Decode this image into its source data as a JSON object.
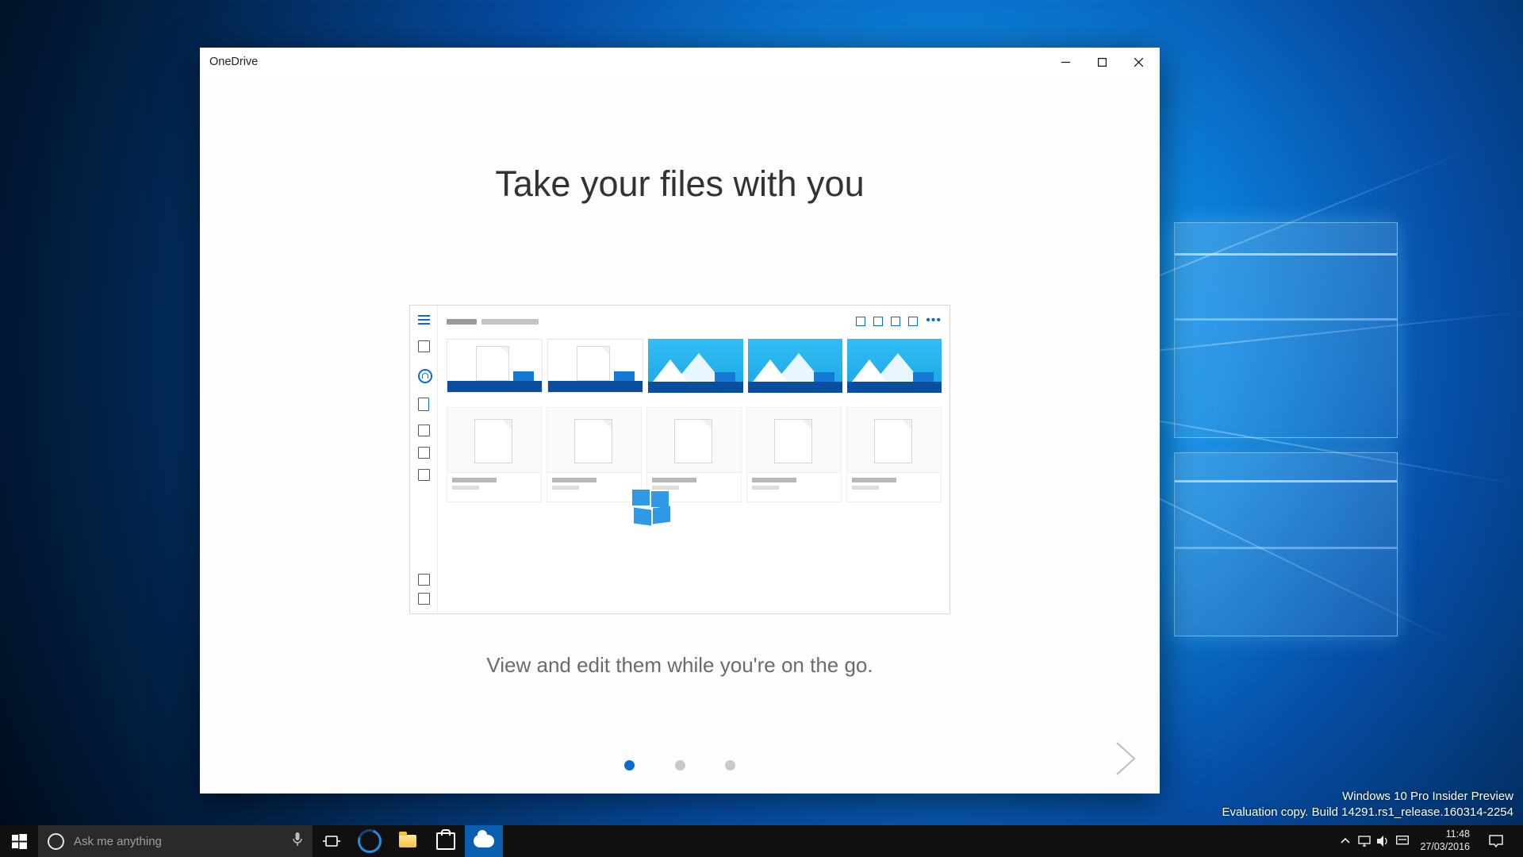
{
  "window": {
    "title": "OneDrive",
    "heading": "Take your files with you",
    "subheading": "View and edit them while you're on the go.",
    "page_indicator": {
      "current": 1,
      "total": 3
    }
  },
  "taskbar": {
    "search_placeholder": "Ask me anything",
    "tray": {
      "time": "11:48",
      "date": "27/03/2016"
    }
  },
  "watermark": {
    "line1": "Windows 10 Pro Insider Preview",
    "line2": "Evaluation copy. Build 14291.rs1_release.160314-2254"
  }
}
